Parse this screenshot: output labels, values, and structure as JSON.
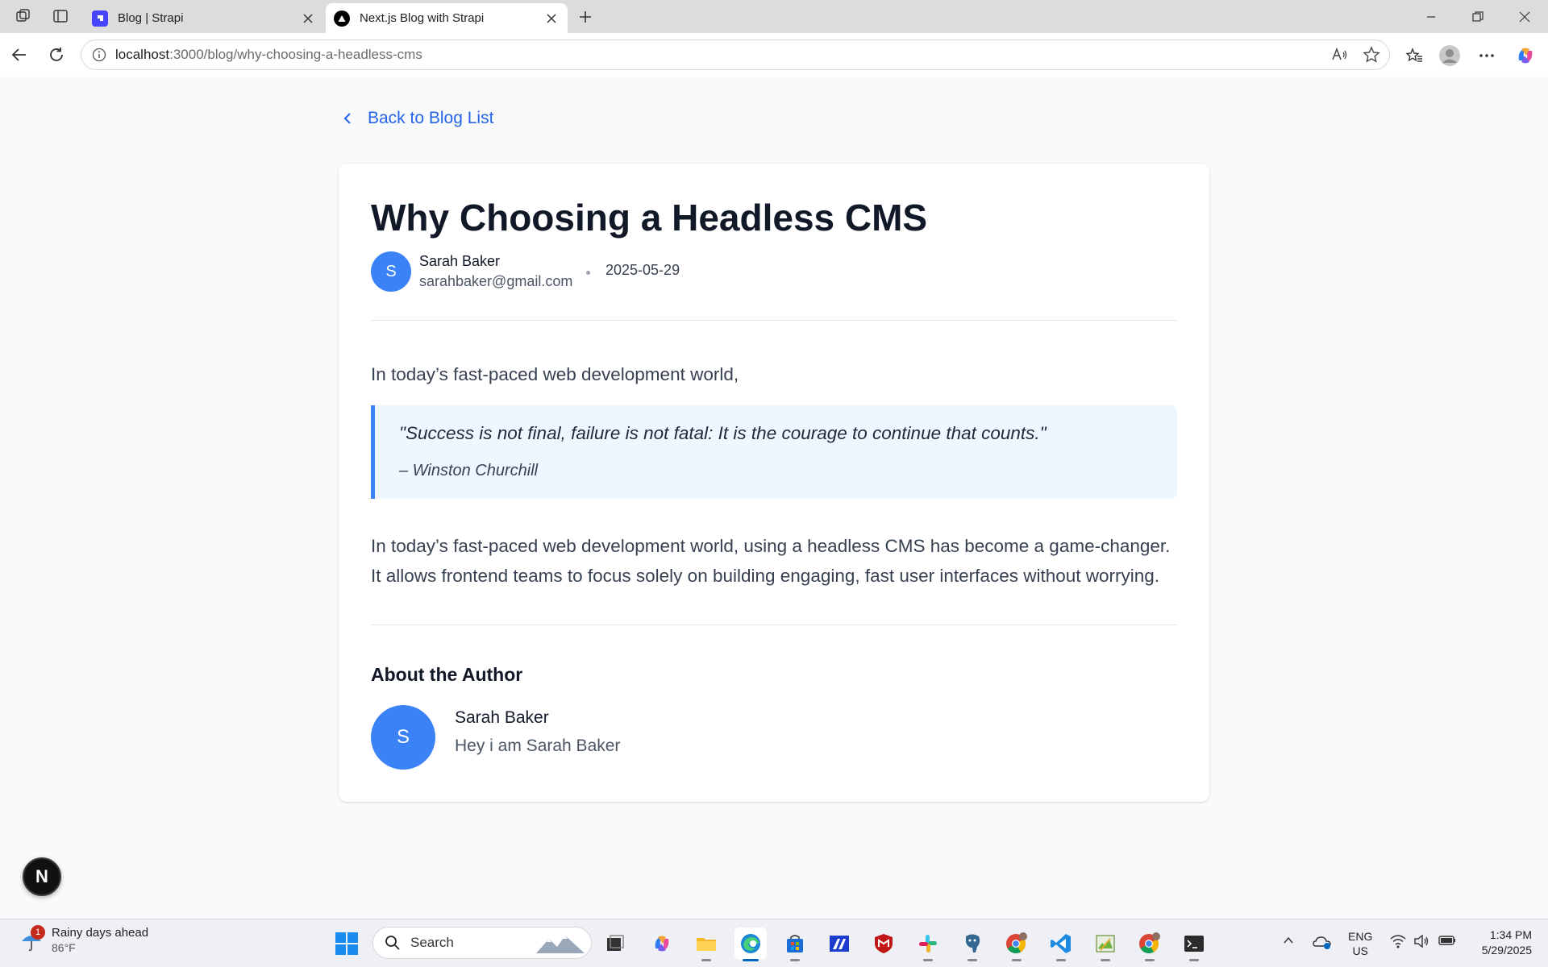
{
  "browser": {
    "tabs": [
      {
        "title": "Blog | Strapi",
        "active": false
      },
      {
        "title": "Next.js Blog with Strapi",
        "active": true
      }
    ],
    "url": {
      "host": "localhost",
      "rest": ":3000/blog/why-choosing-a-headless-cms"
    }
  },
  "page": {
    "back_label": "Back to Blog List",
    "title": "Why Choosing a Headless CMS",
    "author": {
      "initial": "S",
      "name": "Sarah Baker",
      "email": "sarahbaker@gmail.com"
    },
    "date": "2025-05-29",
    "intro": "In today’s fast-paced web development world,",
    "quote": {
      "text": "\"Success is not final, failure is not fatal: It is the courage to continue that counts.\"",
      "author": "– Winston Churchill"
    },
    "body": "In today’s fast-paced web development world, using a headless CMS has become a game-changer. It allows frontend teams to focus solely on building engaging, fast user interfaces without worrying.",
    "about": {
      "heading": "About the Author",
      "initial": "S",
      "name": "Sarah Baker",
      "bio": "Hey i am Sarah Baker"
    },
    "dev_badge": "N"
  },
  "taskbar": {
    "weather": {
      "badge": "1",
      "title": "Rainy days ahead",
      "temp": "86°F"
    },
    "search_label": "Search",
    "lang": {
      "line1": "ENG",
      "line2": "US"
    },
    "clock": {
      "time": "1:34 PM",
      "date": "5/29/2025"
    }
  },
  "colors": {
    "accent": "#2563eb",
    "avatar": "#3b82f6",
    "quote_bg": "#eff6ff"
  }
}
